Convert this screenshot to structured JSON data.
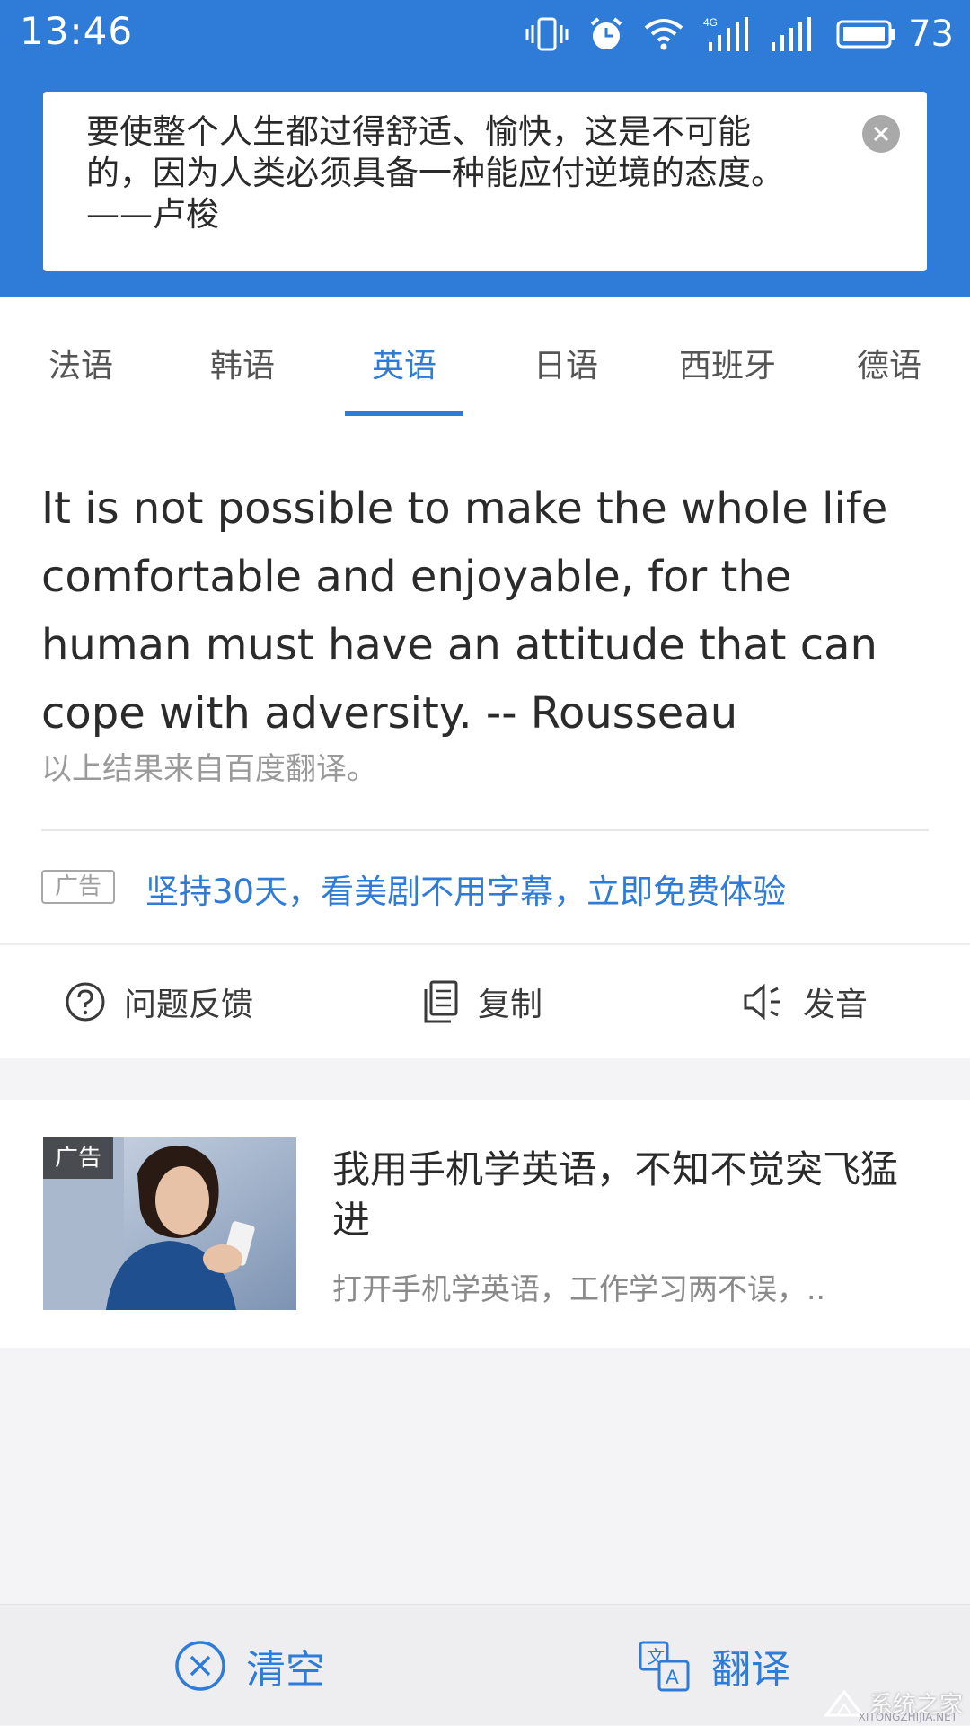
{
  "status_bar": {
    "time": "13:46",
    "battery": "73",
    "network": "4G"
  },
  "quote": {
    "text": "要使整个人生都过得舒适、愉快，这是不可能\n的，因为人类必须具备一种能应付逆境的态度。\n——卢梭"
  },
  "languages": {
    "tabs": [
      "法语",
      "韩语",
      "英语",
      "日语",
      "西班牙",
      "德语"
    ],
    "active": "英语"
  },
  "result": {
    "translation": "It is not possible to make the whole life comfortable and enjoyable, for the human must have an attitude that can cope with adversity. -- Rousseau",
    "source_note": "以上结果来自百度翻译。",
    "ad_badge": "广告",
    "ad_link": "坚持30天，看美剧不用字幕，立即免费体验"
  },
  "actions": {
    "feedback": "问题反馈",
    "copy": "复制",
    "speak": "发音"
  },
  "ad_card": {
    "badge": "广告",
    "title": "我用手机学英语，不知不觉突飞猛进",
    "description": "打开手机学英语，工作学习两不误，.."
  },
  "bottom_bar": {
    "clear": "清空",
    "translate": "翻译"
  },
  "watermark": {
    "text": "系统之家",
    "url": "XITONGZHIJIA.NET"
  },
  "colors": {
    "primary": "#2f7bd8",
    "background": "#f4f4f6"
  }
}
